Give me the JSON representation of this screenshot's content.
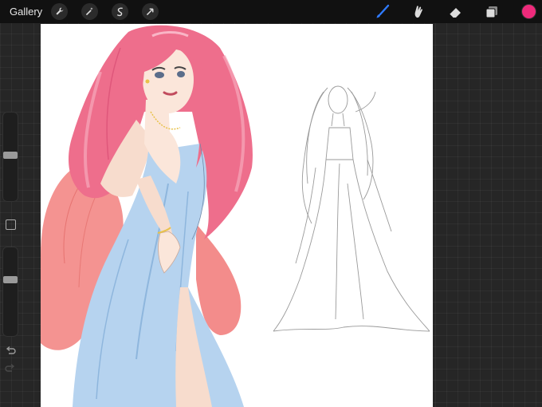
{
  "topbar": {
    "gallery_label": "Gallery",
    "left_tools": [
      "wrench-icon",
      "magic-wand-icon",
      "selection-icon",
      "transform-arrow-icon"
    ],
    "right_tools": [
      "brush-icon",
      "smudge-icon",
      "eraser-icon",
      "layers-icon"
    ],
    "active_tool": "brush-icon",
    "current_color": "#ee2a7b",
    "accent_color": "#2f7bff"
  },
  "sidebar": {
    "brush_size_level": 0.32,
    "opacity_level": 0.36,
    "icons": [
      "modify-square-icon",
      "undo-icon",
      "redo-icon"
    ]
  },
  "canvas": {
    "background": "#ffffff",
    "artwork": [
      "color-illustration-woman-blue-gown",
      "pencil-sketch-woman-gown"
    ]
  }
}
